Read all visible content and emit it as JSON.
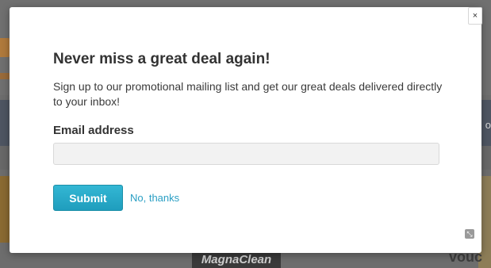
{
  "background": {
    "nav_partial_text": "o",
    "product_brand": "MagnaClean",
    "voucher_partial_text": "vouc"
  },
  "modal": {
    "title": "Never miss a great deal again!",
    "description": "Sign up to our promotional mailing list and get our great deals delivered directly to your inbox!",
    "email_label": "Email address",
    "email_value": "",
    "email_placeholder": "",
    "submit_label": "Submit",
    "decline_label": "No, thanks",
    "close_label": "×",
    "resize_icon": "resize-icon"
  },
  "colors": {
    "accent": "#1f9dbd",
    "link": "#2a9fc4",
    "overlay": "#6d6d6d"
  }
}
